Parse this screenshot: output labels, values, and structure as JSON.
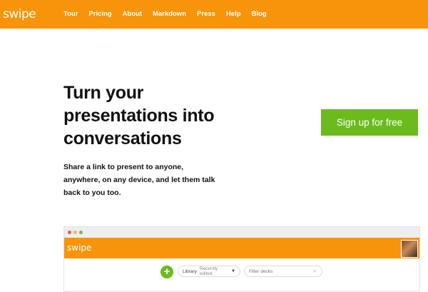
{
  "nav": {
    "logo": "swipe",
    "links": [
      "Tour",
      "Pricing",
      "About",
      "Markdown",
      "Press",
      "Help",
      "Blog"
    ]
  },
  "hero": {
    "title_lines": [
      "Turn your",
      "presentations into",
      "conversations"
    ],
    "subtitle_lines": [
      "Share a link to present to anyone,",
      "anywhere, on any device, and let them talk",
      "back to you too."
    ],
    "cta": "Sign up for free"
  },
  "mock": {
    "logo": "swipe",
    "add_label": "+",
    "library_label": "Library",
    "library_value": "Recently edited",
    "filter_placeholder": "Filter decks",
    "icons": [
      "plus-icon",
      "chevron-down-icon",
      "search-icon"
    ]
  },
  "colors": {
    "brand": "#f7940a",
    "cta": "#6bbb1f",
    "text": "#111111"
  }
}
